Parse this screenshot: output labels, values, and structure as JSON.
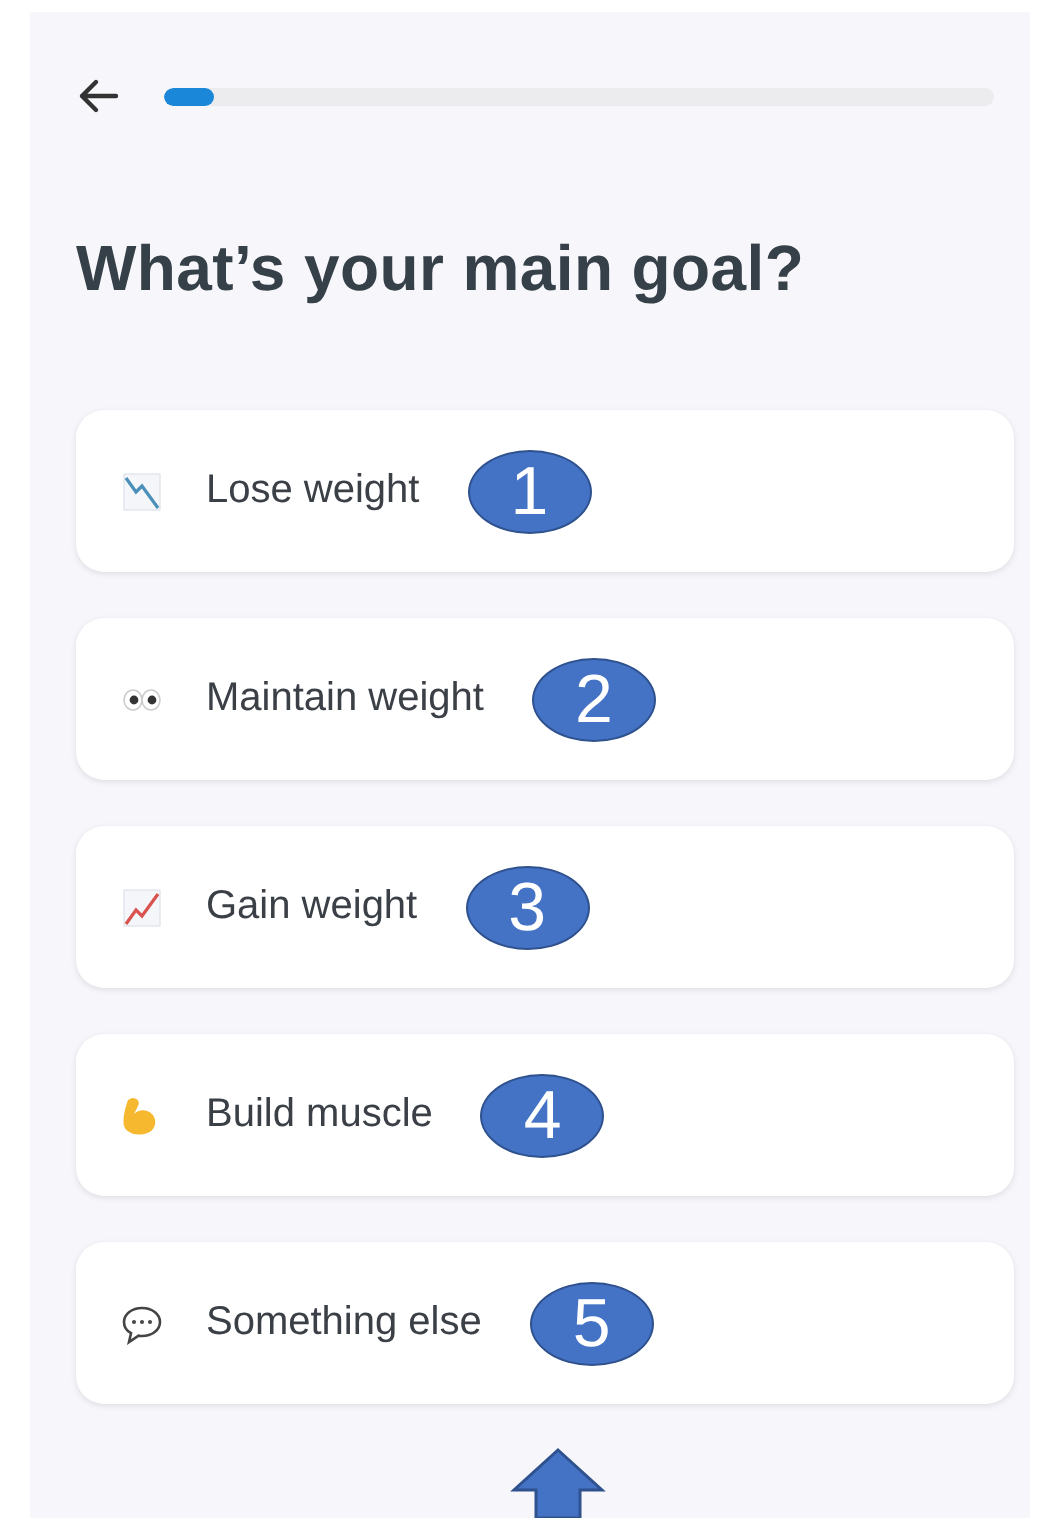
{
  "progress": {
    "level": 0.06
  },
  "title": "What’s your main goal?",
  "options": [
    {
      "kind": "chartdown",
      "label": "Lose weight",
      "badge": "1"
    },
    {
      "kind": "eyes",
      "label": "Maintain weight",
      "badge": "2"
    },
    {
      "kind": "chartup",
      "label": "Gain weight",
      "badge": "3"
    },
    {
      "kind": "muscle",
      "label": "Build muscle",
      "badge": "4"
    },
    {
      "kind": "speech",
      "label": "Something else",
      "badge": "5"
    }
  ]
}
